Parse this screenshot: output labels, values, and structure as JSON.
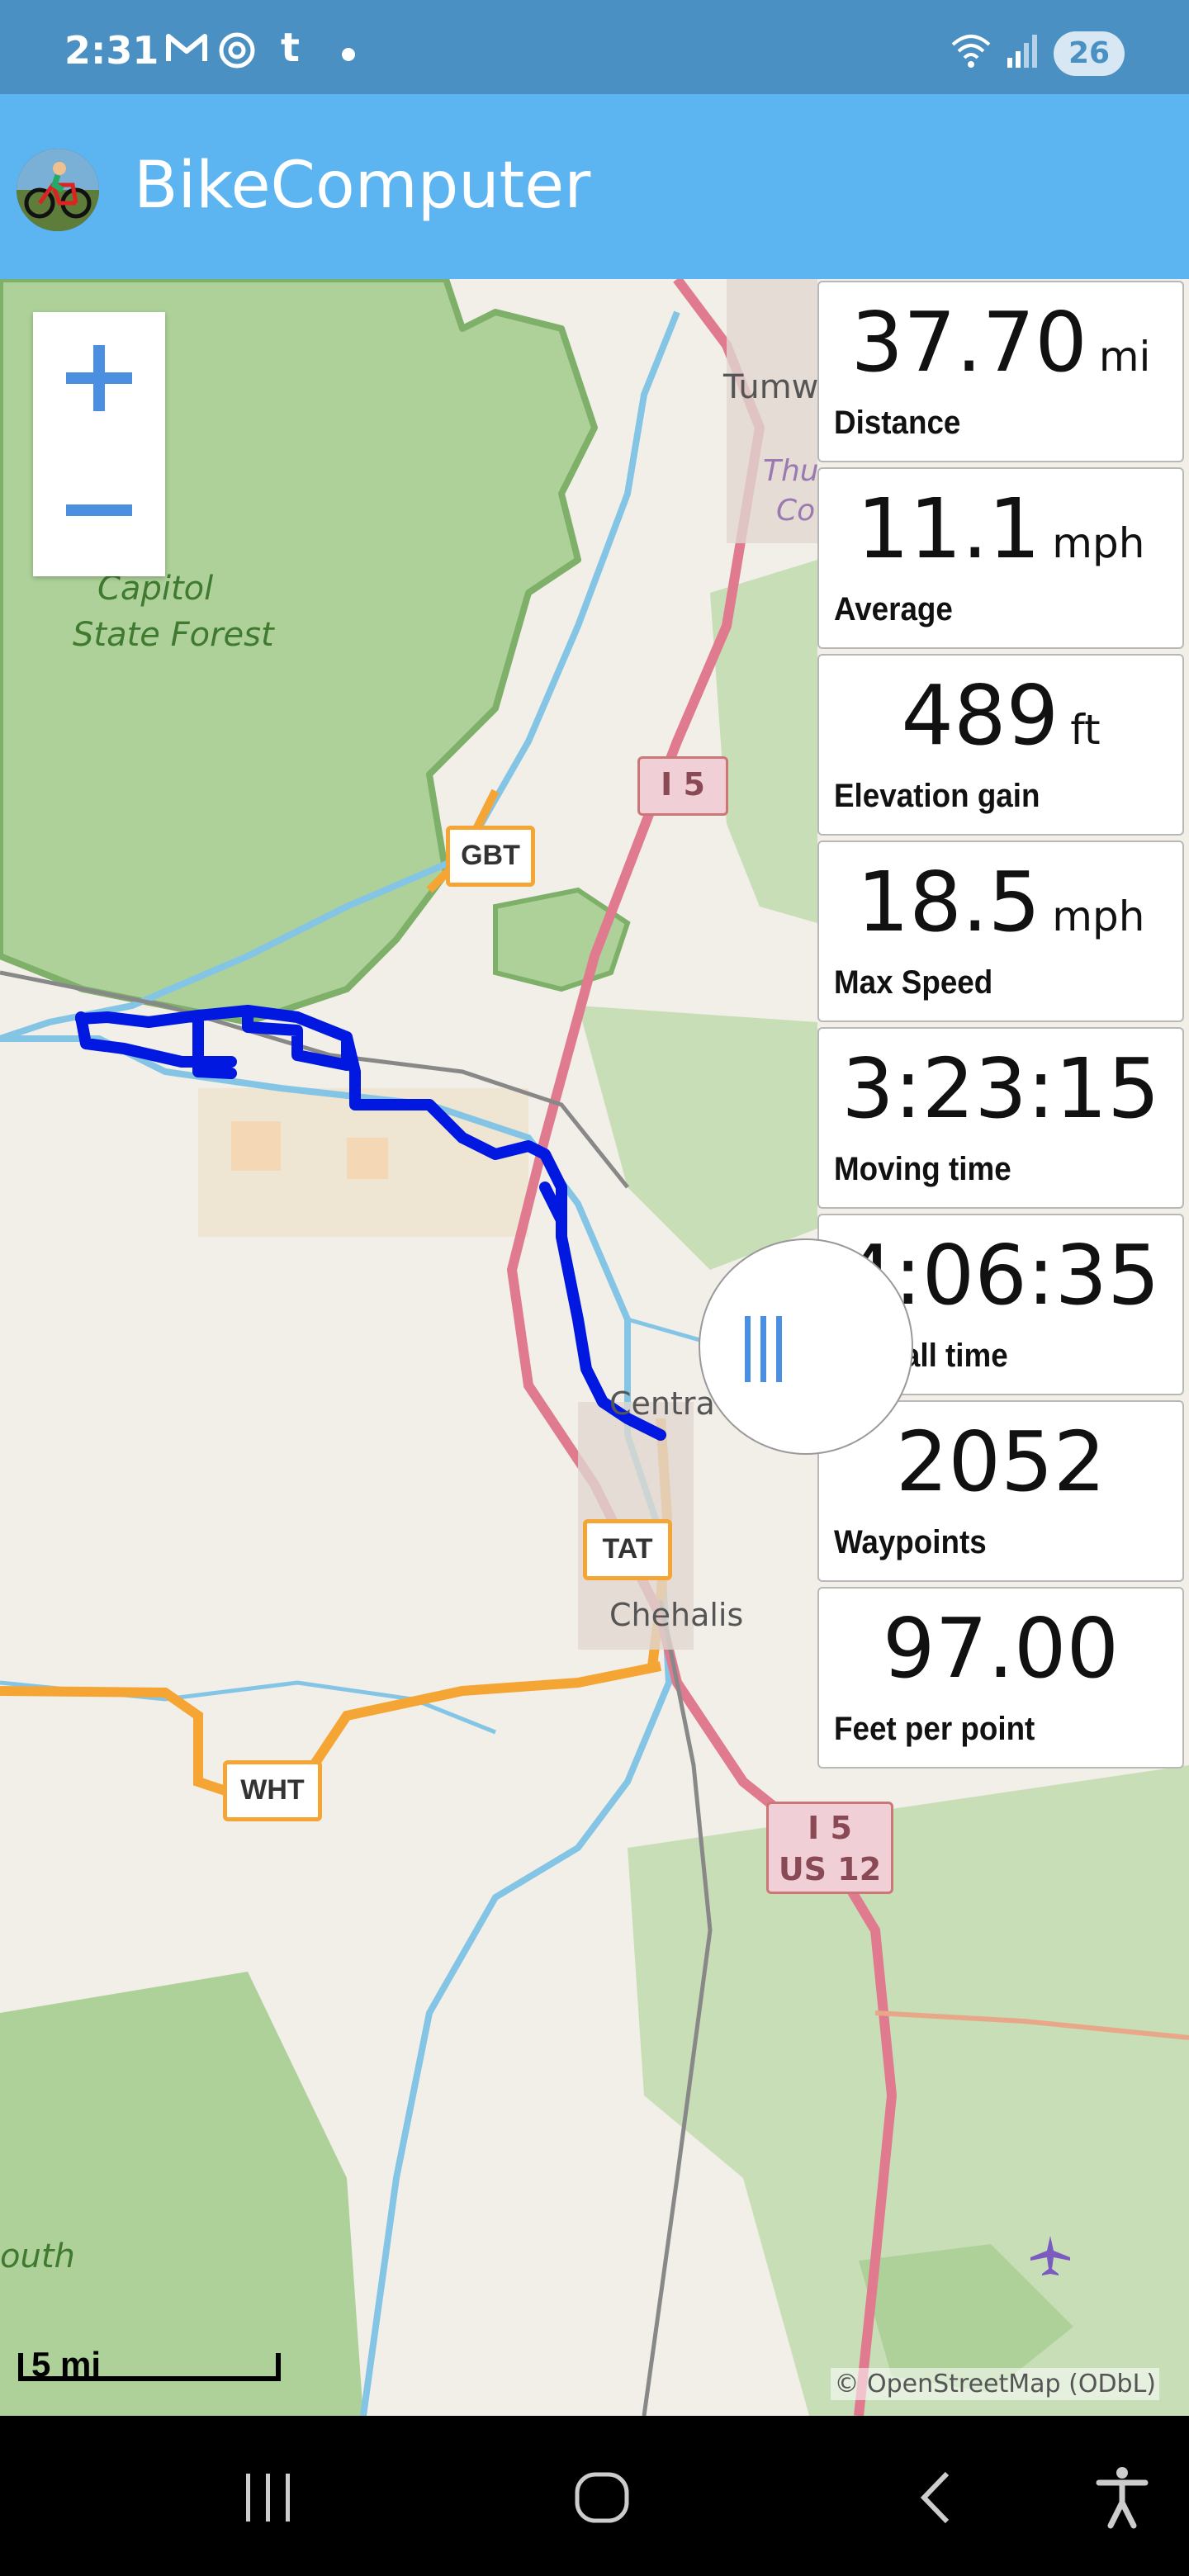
{
  "status_bar": {
    "time": "2:31",
    "icons": [
      "gmail-icon",
      "threads-icon",
      "tumblr-icon",
      "dot-icon"
    ],
    "tumblr_glyph": "t",
    "right_icons": [
      "wifi-icon",
      "signal-icon"
    ],
    "battery": "26"
  },
  "app_bar": {
    "title": "BikeComputer",
    "logo_icon": "bicycle-logo-icon"
  },
  "map": {
    "labels": {
      "forest_line1": "Capitol",
      "forest_line2": "State Forest",
      "tumwater": "Tumw",
      "thurston1": "Thu",
      "thurston2": "Co",
      "centralia": "Centra",
      "chehalis": "Chehalis",
      "south": "outh"
    },
    "shields": {
      "i5_top": "I 5",
      "gbt": "GBT",
      "tat": "TAT",
      "wht": "WHT",
      "i5_bottom_line1": "I 5",
      "i5_bottom_line2": "US 12"
    },
    "scale_label": "5 mi",
    "attribution": "© OpenStreetMap (ODbL)",
    "colors": {
      "track": "#0018e0",
      "forest": "#aed19a",
      "interstate": "#e07a8f",
      "highway": "#f5a534",
      "water": "#84c5e6"
    }
  },
  "stats": [
    {
      "value": "37.70",
      "unit": "mi",
      "label": "Distance"
    },
    {
      "value": "11.1",
      "unit": "mph",
      "label": "Average"
    },
    {
      "value": "489",
      "unit": "ft",
      "label": "Elevation gain"
    },
    {
      "value": "18.5",
      "unit": "mph",
      "label": "Max Speed"
    },
    {
      "value": "3:23:15",
      "unit": "",
      "label": "Moving time"
    },
    {
      "value": "4:06:35",
      "unit": "",
      "label": "Overall time"
    },
    {
      "value": "2052",
      "unit": "",
      "label": "Waypoints"
    },
    {
      "value": "97.00",
      "unit": "",
      "label": "Feet per point"
    }
  ],
  "nav_bar": {
    "buttons": [
      "recents-icon",
      "home-icon",
      "back-icon",
      "accessibility-icon"
    ]
  }
}
